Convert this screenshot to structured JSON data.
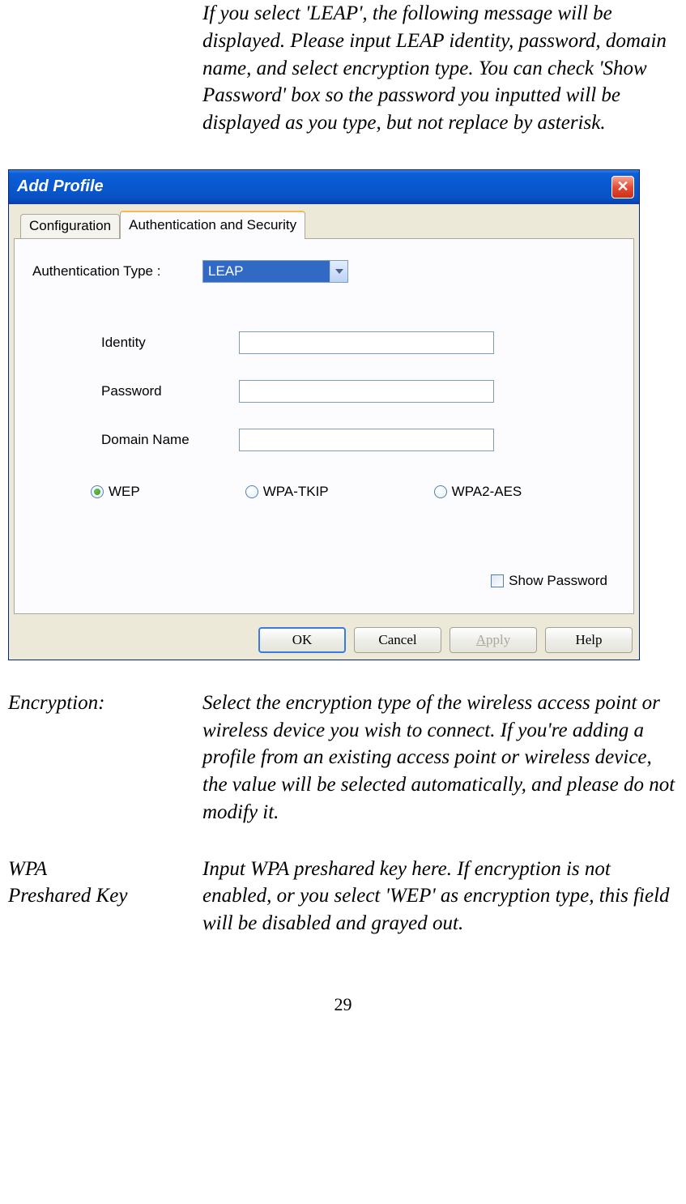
{
  "intro_para": "If you select 'LEAP', the following message will be displayed. Please input LEAP identity, password, domain name, and select encryption type. You can check 'Show Password' box so the password you inputted will be displayed as you type, but not replace by asterisk.",
  "dialog": {
    "title": "Add Profile",
    "tabs": {
      "config": "Configuration",
      "auth": "Authentication and Security"
    },
    "auth_type_label": "Authentication Type :",
    "auth_type_value": "LEAP",
    "identity_label": "Identity",
    "password_label": "Password",
    "domain_label": "Domain Name",
    "radios": {
      "wep": "WEP",
      "tkip": "WPA-TKIP",
      "aes": "WPA2-AES"
    },
    "show_password": "Show Password",
    "buttons": {
      "ok": "OK",
      "cancel": "Cancel",
      "apply_pre": "A",
      "apply_post": "pply",
      "help": "Help"
    }
  },
  "defs": {
    "encryption_label": "Encryption:",
    "encryption_text": "Select the encryption type of the wireless access point or wireless device you wish to connect. If you're adding a profile from an existing access point or wireless device, the value will be selected automatically, and please do not modify it.",
    "wpa_label_1": "WPA",
    "wpa_label_2": "Preshared Key",
    "wpa_text": "Input WPA preshared key here. If encryption is not enabled, or you select 'WEP' as encryption type, this field will be disabled and grayed out."
  },
  "page_number": "29"
}
